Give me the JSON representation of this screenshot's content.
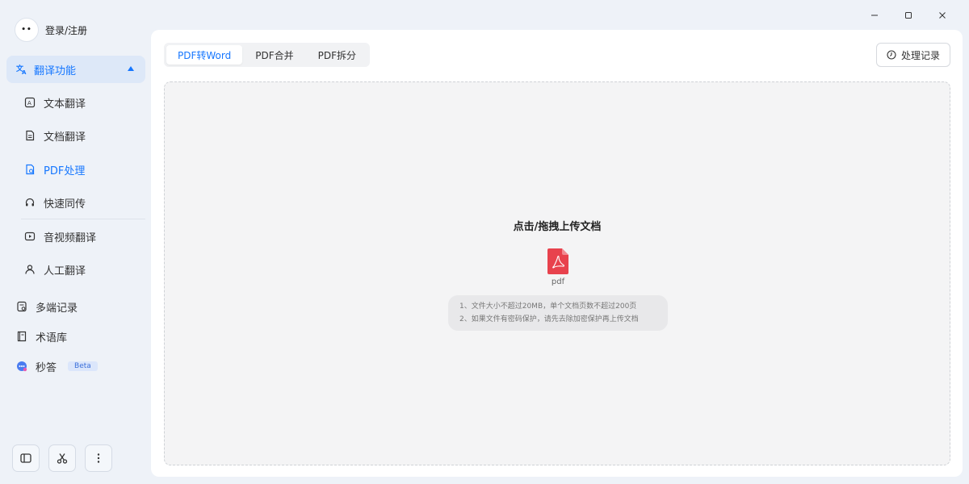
{
  "user": {
    "avatar_text": "••",
    "login_label": "登录/注册"
  },
  "window_controls": [
    "minimize",
    "maximize",
    "close"
  ],
  "sidebar": {
    "group": {
      "label": "翻译功能",
      "icon": "translate-icon",
      "expanded": true
    },
    "sub_items": [
      {
        "label": "文本翻译",
        "icon": "text-translate-icon"
      },
      {
        "label": "文档翻译",
        "icon": "document-icon"
      },
      {
        "label": "PDF处理",
        "icon": "pdf-process-icon",
        "active": true
      },
      {
        "label": "快速同传",
        "icon": "headset-icon"
      },
      {
        "label": "音视频翻译",
        "icon": "video-icon"
      },
      {
        "label": "人工翻译",
        "icon": "person-icon"
      }
    ],
    "main_items": [
      {
        "label": "多端记录",
        "icon": "record-icon"
      },
      {
        "label": "术语库",
        "icon": "book-icon"
      },
      {
        "label": "秒答",
        "icon": "ai-chat-icon",
        "badge": "Beta"
      }
    ],
    "bottom_buttons": [
      "sidebar-toggle-icon",
      "scissors-icon",
      "more-vertical-icon"
    ]
  },
  "main": {
    "tabs": [
      {
        "label": "PDF转Word",
        "active": true
      },
      {
        "label": "PDF合并"
      },
      {
        "label": "PDF拆分"
      }
    ],
    "history_button": "处理记录",
    "dropzone": {
      "title": "点击/拖拽上传文档",
      "file_type": "pdf",
      "notes": [
        "1、文件大小不超过20MB，单个文档页数不超过200页",
        "2、如果文件有密码保护，请先去除加密保护再上传文档"
      ]
    }
  },
  "colors": {
    "accent": "#1677ff",
    "pdf_red": "#e8424d",
    "active_bg": "#dde8f8"
  }
}
